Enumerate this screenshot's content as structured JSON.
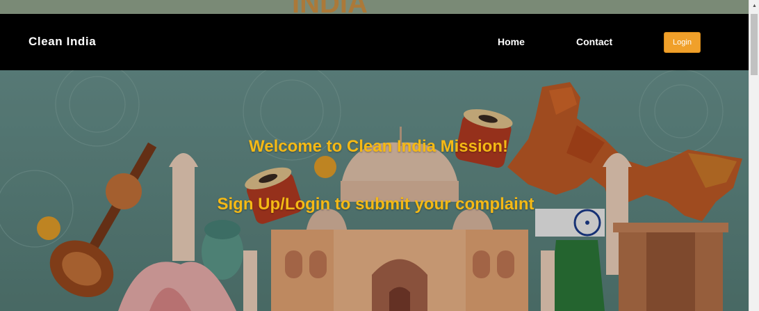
{
  "navbar": {
    "brand": "Clean India",
    "links": [
      "Home",
      "Contact"
    ],
    "login_label": "Login"
  },
  "hero": {
    "welcome": "Welcome to Clean India Mission!",
    "cta": "Sign Up/Login to submit your complaint"
  },
  "colors": {
    "navbar_bg": "#000000",
    "accent": "#f0a02a",
    "headline": "#f5b915"
  }
}
